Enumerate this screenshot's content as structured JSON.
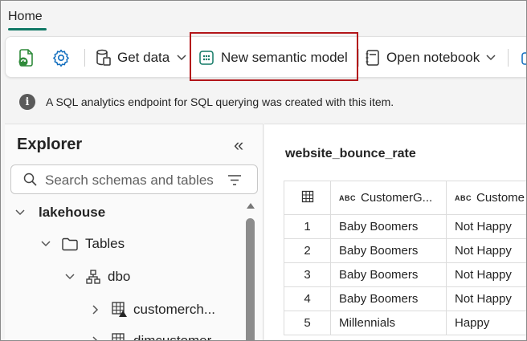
{
  "tab": {
    "label": "Home"
  },
  "toolbar": {
    "get_data": "Get data",
    "new_semantic_model": "New semantic model",
    "open_notebook": "Open notebook"
  },
  "info": {
    "text": "A SQL analytics endpoint for SQL querying was created with this item."
  },
  "explorer": {
    "title": "Explorer",
    "search_placeholder": "Search schemas and tables",
    "tree": {
      "lakehouse": "lakehouse",
      "tables": "Tables",
      "dbo": "dbo",
      "customerch": "customerch...",
      "dimcustomer": "dimcustomer"
    }
  },
  "table": {
    "title": "website_bounce_rate",
    "col_type": "ABC",
    "headers": [
      "CustomerG...",
      "Custome"
    ],
    "rows": [
      [
        "1",
        "Baby Boomers",
        "Not Happy"
      ],
      [
        "2",
        "Baby Boomers",
        "Not Happy"
      ],
      [
        "3",
        "Baby Boomers",
        "Not Happy"
      ],
      [
        "4",
        "Baby Boomers",
        "Not Happy"
      ],
      [
        "5",
        "Millennials",
        "Happy"
      ]
    ]
  },
  "colors": {
    "accent": "#117865",
    "highlight": "#b3161a"
  }
}
